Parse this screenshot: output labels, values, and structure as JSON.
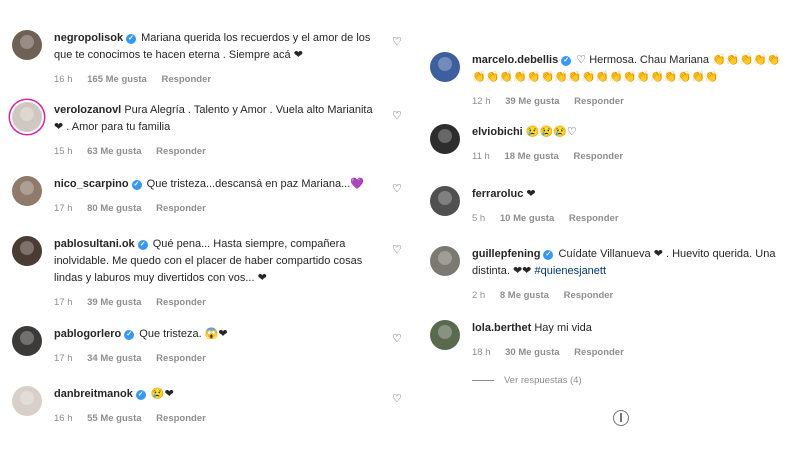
{
  "left_comments": [
    {
      "username": "negropolisok",
      "text": "Mariana querida los recuerdos y el amor de los que te conocimos te hacen eterna . Siempre acá ❤",
      "time": "16 h",
      "likes": "165 Me gusta",
      "reply": "Responder",
      "avatar_color": "#6f6255"
    },
    {
      "username": "verolozanovl",
      "text": "Pura Alegría . Talento y Amor . Vuela alto Marianita ❤ . Amor para tu familia",
      "time": "15 h",
      "likes": "63 Me gusta",
      "reply": "Responder",
      "avatar_color": "#cfc8c0"
    },
    {
      "username": "nico_scarpino",
      "text": "Que tristeza...descansá en paz Mariana...💜",
      "time": "17 h",
      "likes": "80 Me gusta",
      "reply": "Responder",
      "avatar_color": "#8f7a6c"
    },
    {
      "username": "pablosultani.ok",
      "text": "Qué pena... Hasta siempre, compañera inolvidable. Me quedo con el placer de haber compartido cosas lindas y laburos muy divertidos con vos... ❤",
      "time": "17 h",
      "likes": "39 Me gusta",
      "reply": "Responder",
      "avatar_color": "#4a3b33"
    },
    {
      "username": "pablogorlero",
      "text": "Que tristeza. 😱❤",
      "time": "17 h",
      "likes": "34 Me gusta",
      "reply": "Responder",
      "avatar_color": "#3c3a38"
    },
    {
      "username": "danbreitmanok",
      "text": "😢❤",
      "time": "16 h",
      "likes": "55 Me gusta",
      "reply": "Responder",
      "avatar_color": "#d8d0c8"
    }
  ],
  "right_comments": [
    {
      "username": "marcelo.debellis",
      "text": "♡ Hermosa. Chau Mariana 👏👏👏👏👏👏👏👏👏👏👏👏👏👏👏👏👏👏👏👏👏👏👏",
      "time": "12 h",
      "likes": "39 Me gusta",
      "reply": "Responder",
      "avatar_color": "#3d5f9e",
      "verified": true
    },
    {
      "username": "elviobichi",
      "text": "😢😢😢♡",
      "time": "11 h",
      "likes": "18 Me gusta",
      "reply": "Responder",
      "avatar_color": "#2d2d2d",
      "verified": false
    },
    {
      "username": "ferraroluc",
      "text": "❤",
      "time": "5 h",
      "likes": "10 Me gusta",
      "reply": "Responder",
      "avatar_color": "#505050",
      "verified": false
    },
    {
      "username": "guillepfening",
      "text": "Cuídate Villanueva ❤ . Huevito querida. Una distinta. ❤❤",
      "hashtag": "#quienesjanett",
      "time": "2 h",
      "likes": "8 Me gusta",
      "reply": "Responder",
      "avatar_color": "#7c7872",
      "verified": true
    },
    {
      "username": "lola.berthet",
      "text": "Hay mi vida",
      "time": "18 h",
      "likes": "30 Me gusta",
      "reply": "Responder",
      "avatar_color": "#5a6a4e",
      "verified": false
    }
  ],
  "view_replies": "Ver respuestas (4)",
  "colors": {
    "verified": "#3897f0",
    "heart": "#ed4956",
    "muted": "#8e8e8e"
  }
}
